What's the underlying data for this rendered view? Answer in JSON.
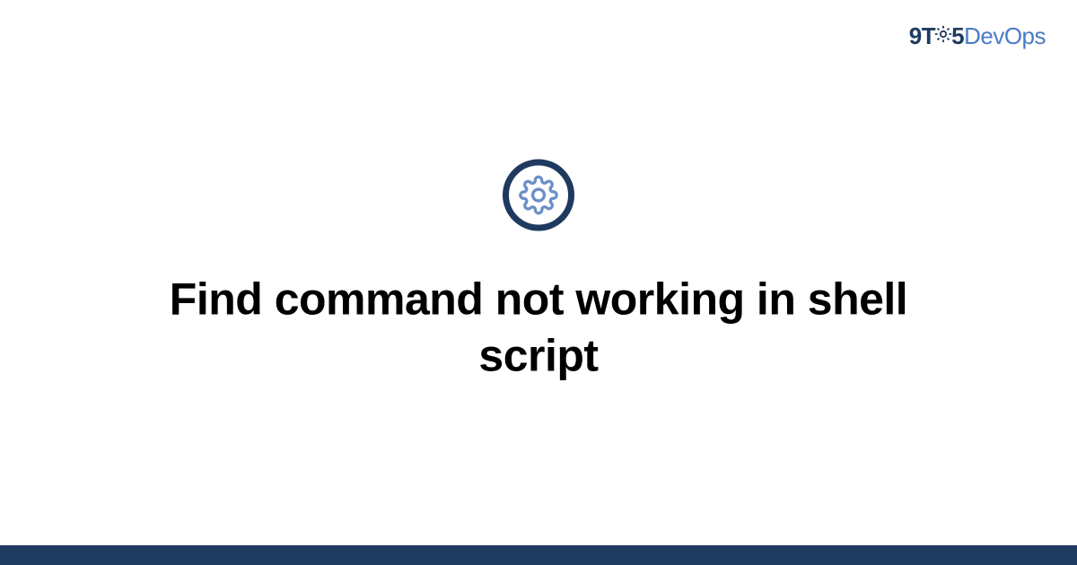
{
  "logo": {
    "part1": "9T",
    "part2": "5",
    "part3": "DevOps"
  },
  "title": "Find command not working in shell script",
  "colors": {
    "darkBlue": "#1e3a5f",
    "lightBlue": "#4a7bc8",
    "gearBlue": "#6b8fc9"
  }
}
